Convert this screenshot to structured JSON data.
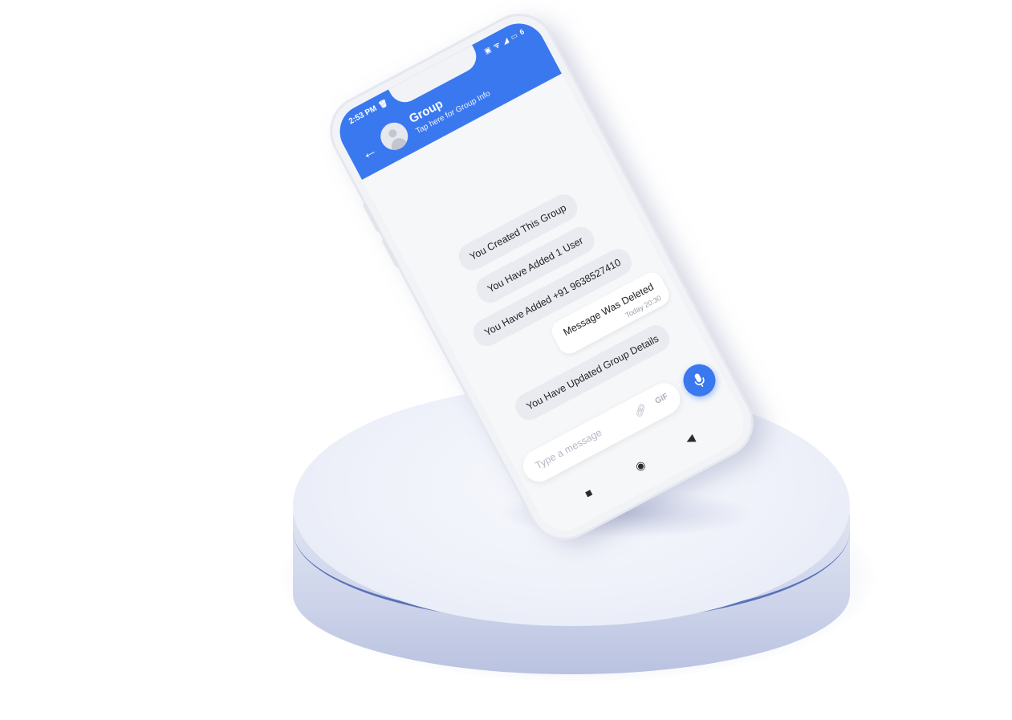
{
  "status_bar": {
    "time": "2:53 PM",
    "right": "▣ ᯤ ◢ ▭ 6"
  },
  "header": {
    "title": "Group",
    "subtitle": "Tap here for Group Info"
  },
  "messages": [
    {
      "kind": "system",
      "text": "You Created This Group"
    },
    {
      "kind": "system",
      "text": "You Have Added 1 User"
    },
    {
      "kind": "system",
      "text": "You Have Added +91 9638527410"
    },
    {
      "kind": "message",
      "text": "Message Was Deleted",
      "time": "Today 20:30"
    },
    {
      "kind": "system",
      "text": "You Have Updated Group Details"
    }
  ],
  "composer": {
    "placeholder": "Type a message",
    "gif_label": "GIF"
  },
  "colors": {
    "accent": "#3a78ef",
    "pedestal_ring": "#5a72b8"
  },
  "icons": {
    "back": "back-arrow-icon",
    "mic": "microphone-icon",
    "link": "link-icon",
    "trash": "trash-icon"
  }
}
